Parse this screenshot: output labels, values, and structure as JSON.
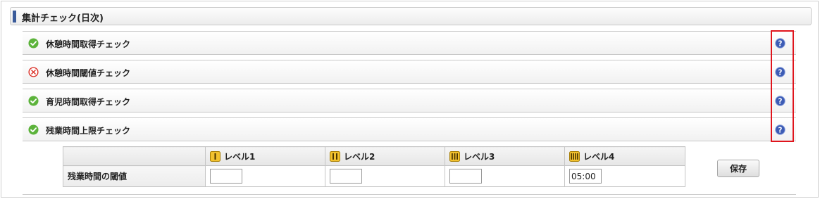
{
  "section": {
    "title": "集計チェック(日次)"
  },
  "checks": [
    {
      "label": "休憩時間取得チェック",
      "status": "ok"
    },
    {
      "label": "休憩時間閾値チェック",
      "status": "error"
    },
    {
      "label": "育児時間取得チェック",
      "status": "ok"
    },
    {
      "label": "残業時間上限チェック",
      "status": "ok"
    }
  ],
  "threshold_table": {
    "headers": [
      "レベル1",
      "レベル2",
      "レベル3",
      "レベル4"
    ],
    "row_label": "残業時間の閾値",
    "values": [
      "",
      "",
      "",
      "05:00"
    ]
  },
  "save_label": "保存",
  "colors": {
    "accent_bar": "#3a5b9a",
    "ok": "#5cb33b",
    "error": "#d9261c",
    "help": "#3d5cb5",
    "highlight": "#e0141c"
  }
}
